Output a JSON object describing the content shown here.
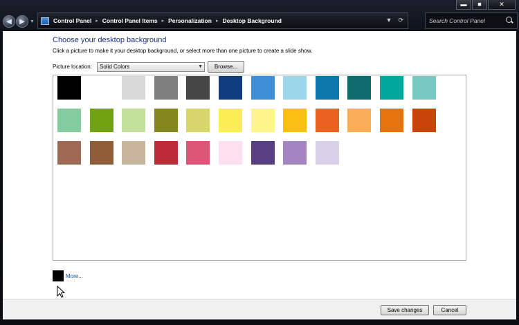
{
  "window": {
    "caption_buttons": {
      "minimize": "▬",
      "maximize": "■",
      "close": "✕"
    }
  },
  "nav": {
    "back_icon": "◀",
    "forward_icon": "▶",
    "history_icon": "▼",
    "breadcrumb": [
      "Control Panel",
      "Control Panel Items",
      "Personalization",
      "Desktop Background"
    ],
    "breadcrumb_separator": "▸",
    "dropdown_icon": "▼",
    "refresh_icon": "⟳",
    "search_placeholder": "Search Control Panel"
  },
  "page": {
    "title": "Choose your desktop background",
    "subtitle": "Click a picture to make it your desktop background, or select more than one picture to create a slide show.",
    "picture_location_label": "Picture location:",
    "picture_location_value": "Solid Colors",
    "browse_label": "Browse...",
    "swatch_rows": [
      [
        "#000000",
        "#ffffff",
        "#d9d9d9",
        "#7f7f7f",
        "#464646",
        "#0f3c7f",
        "#3e8fd5",
        "#9bd7ea",
        "#0b7aaa",
        "#0e6c6c",
        "#00a79d",
        "#77c9c3"
      ],
      [
        "#83cc9d",
        "#70a30f",
        "#c3e09a",
        "#83871e",
        "#d9d56e",
        "#fbee54",
        "#fdf48b",
        "#fbbf13",
        "#ea621f",
        "#fbae58",
        "#e6730d",
        "#c8440b"
      ],
      [
        "#9e6a55",
        "#8f5e38",
        "#c8b39c",
        "#bd2a38",
        "#dc5577",
        "#fde0ed",
        "#583f84",
        "#a285c1",
        "#d9d0e9"
      ]
    ],
    "more_color": "#000000",
    "more_label": "More..."
  },
  "actions": {
    "save_label": "Save changes",
    "cancel_label": "Cancel"
  }
}
